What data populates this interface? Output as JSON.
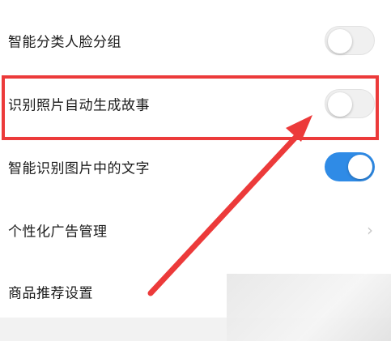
{
  "settings": {
    "rows": [
      {
        "label": "智能分类人脸分组",
        "control": "toggle",
        "state": "off"
      },
      {
        "label": "识别照片自动生成故事",
        "control": "toggle",
        "state": "off"
      },
      {
        "label": "智能识别图片中的文字",
        "control": "toggle",
        "state": "on"
      },
      {
        "label": "个性化广告管理",
        "control": "chevron",
        "chevron": "›"
      },
      {
        "label": "商品推荐设置",
        "control": "none"
      }
    ]
  },
  "colors": {
    "toggle_on": "#2f8be6",
    "toggle_off": "#f0f0f0",
    "annotation": "#ec3a3a"
  },
  "icons": {
    "chevron": "chevron-right-icon",
    "annotation_arrow": "arrow-icon"
  }
}
